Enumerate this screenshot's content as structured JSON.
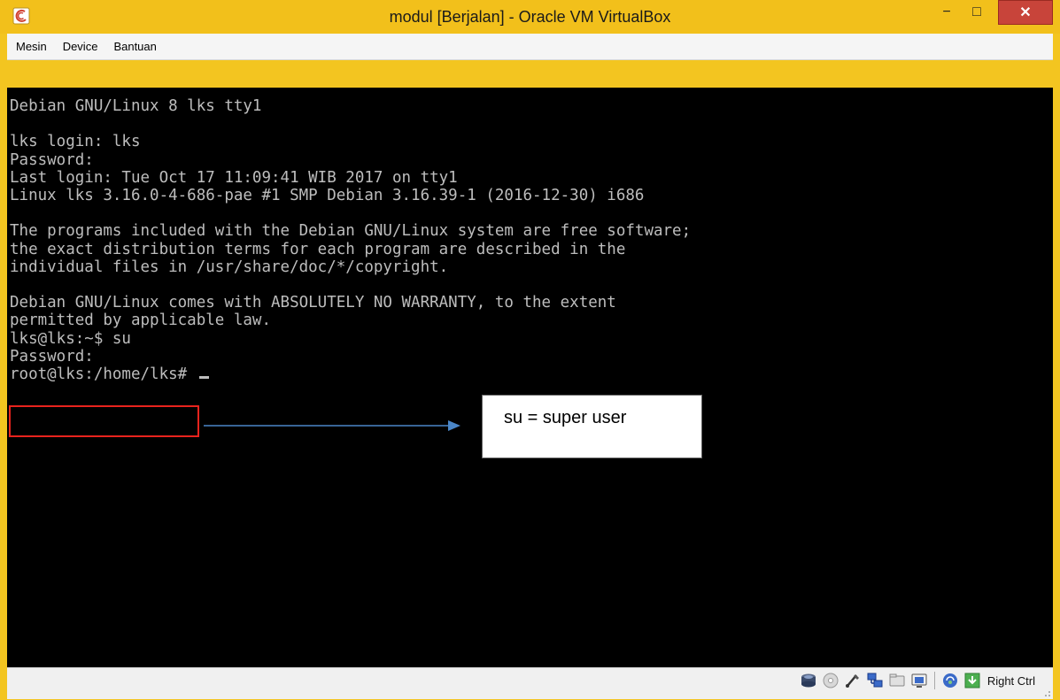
{
  "window": {
    "title": "modul [Berjalan] - Oracle VM VirtualBox",
    "min_label": "−",
    "max_label": "□",
    "close_label": "✕"
  },
  "menu": {
    "items": [
      "Mesin",
      "Device",
      "Bantuan"
    ]
  },
  "terminal": {
    "lines": [
      "Debian GNU/Linux 8 lks tty1",
      "",
      "lks login: lks",
      "Password:",
      "Last login: Tue Oct 17 11:09:41 WIB 2017 on tty1",
      "Linux lks 3.16.0-4-686-pae #1 SMP Debian 3.16.39-1 (2016-12-30) i686",
      "",
      "The programs included with the Debian GNU/Linux system are free software;",
      "the exact distribution terms for each program are described in the",
      "individual files in /usr/share/doc/*/copyright.",
      "",
      "Debian GNU/Linux comes with ABSOLUTELY NO WARRANTY, to the extent",
      "permitted by applicable law.",
      "lks@lks:~$ su",
      "Password:",
      "root@lks:/home/lks# "
    ]
  },
  "annotation": {
    "callout_text": "su = super user"
  },
  "statusbar": {
    "host_key": "Right Ctrl",
    "icons": [
      "hard-disk-icon",
      "optical-drive-icon",
      "usb-icon",
      "network-icon",
      "shared-folders-icon",
      "display-icon",
      "video-capture-icon",
      "mouse-integration-icon",
      "keyboard-capture-icon"
    ]
  },
  "colors": {
    "title_bar": "#f2c01b",
    "close_button": "#c8443a",
    "terminal_bg": "#000000",
    "terminal_fg": "#bdbdbd",
    "highlight": "#e8231d",
    "arrow": "#4a86c8"
  }
}
